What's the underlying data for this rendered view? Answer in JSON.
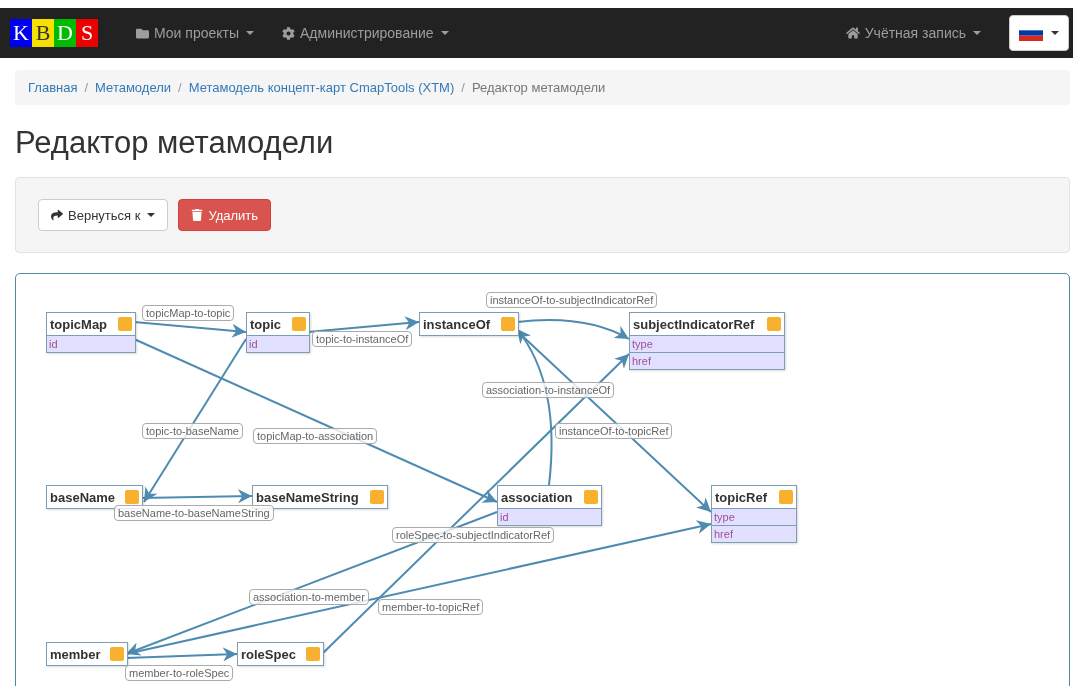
{
  "navbar": {
    "logo_letters": [
      "K",
      "B",
      "D",
      "S"
    ],
    "menus": [
      "Мои проекты",
      "Администрирование"
    ],
    "account": "Учётная запись"
  },
  "breadcrumb": [
    {
      "label": "Главная",
      "current": false
    },
    {
      "separator": "/",
      "label": "Метамодели",
      "current": false
    },
    {
      "separator": "/",
      "label": "Метамодель концепт-карт CmapTools (XTM)",
      "current": false
    },
    {
      "separator": "/",
      "label": "Редактор метамодели",
      "current": true
    }
  ],
  "page_title": "Редактор метамодели",
  "toolbar": {
    "back_button": "Вернуться к",
    "delete_button": "Удалить"
  },
  "diagram": {
    "nodes": [
      {
        "name": "topicMap",
        "attributes": [
          "id"
        ]
      },
      {
        "name": "topic",
        "attributes": [
          "id"
        ]
      },
      {
        "name": "instanceOf"
      },
      {
        "name": "subjectIndicatorRef",
        "attributes": [
          "type",
          "href"
        ]
      },
      {
        "name": "baseName"
      },
      {
        "name": "baseNameString"
      },
      {
        "name": "association",
        "attributes": [
          "id"
        ]
      },
      {
        "name": "topicRef",
        "attributes": [
          "type",
          "href"
        ]
      },
      {
        "name": "member"
      },
      {
        "name": "roleSpec"
      }
    ],
    "edges": [
      {
        "label": "topicMap-to-topic"
      },
      {
        "label": "topic-to-instanceOf"
      },
      {
        "label": "instanceOf-to-subjectIndicatorRef"
      },
      {
        "label": "topic-to-baseName"
      },
      {
        "label": "topicMap-to-association"
      },
      {
        "label": "association-to-instanceOf"
      },
      {
        "label": "instanceOf-to-topicRef"
      },
      {
        "label": "baseName-to-baseNameString"
      },
      {
        "label": "roleSpec-to-subjectIndicatorRef"
      },
      {
        "label": "association-to-member"
      },
      {
        "label": "member-to-topicRef"
      },
      {
        "label": "member-to-roleSpec"
      }
    ]
  }
}
